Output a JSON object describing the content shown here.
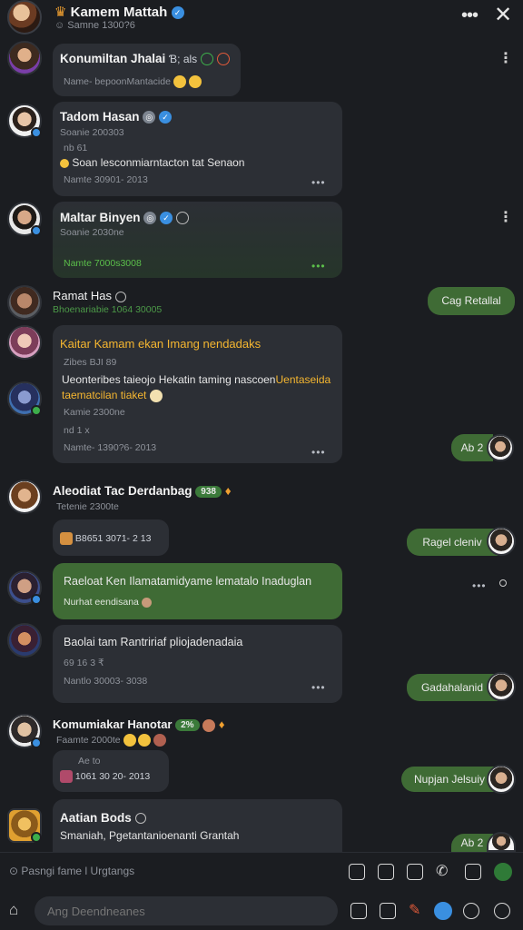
{
  "header": {
    "title": "Kamem Mattah",
    "subtitle": "Samne 1300?6"
  },
  "messages": [
    {
      "name": "Konumiltan Jhalai",
      "name_suffix": "Ɓ; als",
      "line": "Name- bepoonMantacide"
    },
    {
      "name": "Tadom Hasan",
      "meta1": "Soanie 200303",
      "meta2": "nb 61",
      "line": "Soan lesconmiarntacton tat Senaon",
      "time": "Namte 30901- 2013"
    },
    {
      "name": "Maltar Binyen",
      "meta1": "Soanie 2030ne",
      "time": "Namte 7000s3008"
    },
    {
      "name": "Ramat Has",
      "meta1": "Bhoenariabie 1064 30005"
    },
    {
      "title": "Kaitar Kamam ekan Imang nendadaks",
      "meta1": "Zibes BJI 89",
      "line1": "Ueonteribes taieojo Hekatin taming nascoen",
      "line1_accent": "Uentaseida",
      "line2": "taematcilan tiaket",
      "meta2": "Kamie 2300ne",
      "meta3": "nd 1 x",
      "time": "Namte- 1390?6- 2013"
    },
    {
      "name": "Aleodiat Tac Derdanbag",
      "badge": "938",
      "meta1": "Tetenie 2300te",
      "time": "B8651 3071- 2 13"
    },
    {
      "line": "Raeloat Ken Ilamatamidyame lematalo Inaduglan",
      "meta1": "Nurhat eendisana"
    },
    {
      "line": "Baolai tam Rantririaf pliojadenadaia",
      "meta1": "69 16 3 ₹",
      "time": "Nantlo 30003- 3038"
    },
    {
      "name": "Komumiakar Hanotar",
      "badge": "2%",
      "meta1": "Faamte 2000te",
      "meta2": "Ae to",
      "time": "1061 30 20- 2013"
    },
    {
      "name": "Aatian Bods",
      "line": "Smaniah, Pgetantanioenanti Grantah"
    }
  ],
  "right_bubbles": [
    "Cag Retallal",
    "Ab 2",
    "Ragel cleniv",
    "Gadahalanid",
    "Nupjan Jelsuiy",
    "Ab 2"
  ],
  "toolbar": {
    "placeholder": "Pasngi fame l Urgtangs",
    "compose_placeholder": "Ang Deendneanes"
  }
}
